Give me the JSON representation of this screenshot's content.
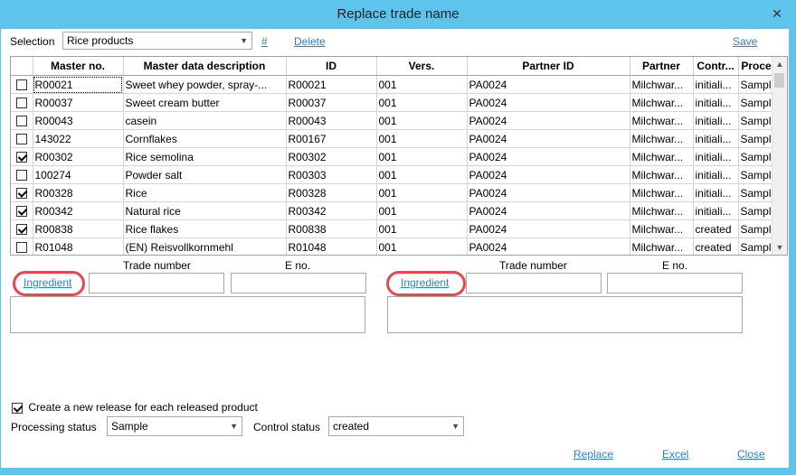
{
  "window": {
    "title": "Replace trade name",
    "close_glyph": "✕"
  },
  "toolbar": {
    "selection_label": "Selection",
    "selection_value": "Rice products",
    "hash_link": "#",
    "delete_link": "Delete",
    "save_link": "Save"
  },
  "grid": {
    "columns": [
      "",
      "Master no.",
      "Master data description",
      "ID",
      "Vers.",
      "Partner ID",
      "Partner",
      "Contr...",
      "Proce"
    ],
    "rows": [
      {
        "checked": false,
        "master_no": "R00021",
        "desc": "Sweet whey powder, spray-...",
        "id": "R00021",
        "vers": "001",
        "partner_id": "PA0024",
        "partner": "Milchwar...",
        "control": "initiali...",
        "process": "Sampl"
      },
      {
        "checked": false,
        "master_no": "R00037",
        "desc": "Sweet cream butter",
        "id": "R00037",
        "vers": "001",
        "partner_id": "PA0024",
        "partner": "Milchwar...",
        "control": "initiali...",
        "process": "Sampl"
      },
      {
        "checked": false,
        "master_no": "R00043",
        "desc": "casein",
        "id": "R00043",
        "vers": "001",
        "partner_id": "PA0024",
        "partner": "Milchwar...",
        "control": "initiali...",
        "process": "Sampl"
      },
      {
        "checked": false,
        "master_no": "143022",
        "desc": "Cornflakes",
        "id": "R00167",
        "vers": "001",
        "partner_id": "PA0024",
        "partner": "Milchwar...",
        "control": "initiali...",
        "process": "Sampl"
      },
      {
        "checked": true,
        "master_no": "R00302",
        "desc": "Rice semolina",
        "id": "R00302",
        "vers": "001",
        "partner_id": "PA0024",
        "partner": "Milchwar...",
        "control": "initiali...",
        "process": "Sampl"
      },
      {
        "checked": false,
        "master_no": "100274",
        "desc": "Powder salt",
        "id": "R00303",
        "vers": "001",
        "partner_id": "PA0024",
        "partner": "Milchwar...",
        "control": "initiali...",
        "process": "Sampl"
      },
      {
        "checked": true,
        "master_no": "R00328",
        "desc": "Rice",
        "id": "R00328",
        "vers": "001",
        "partner_id": "PA0024",
        "partner": "Milchwar...",
        "control": "initiali...",
        "process": "Sampl"
      },
      {
        "checked": true,
        "master_no": "R00342",
        "desc": "Natural rice",
        "id": "R00342",
        "vers": "001",
        "partner_id": "PA0024",
        "partner": "Milchwar...",
        "control": "initiali...",
        "process": "Sampl"
      },
      {
        "checked": true,
        "master_no": "R00838",
        "desc": "Rice flakes",
        "id": "R00838",
        "vers": "001",
        "partner_id": "PA0024",
        "partner": "Milchwar...",
        "control": "created",
        "process": "Sampl"
      },
      {
        "checked": false,
        "master_no": "R01048",
        "desc": "(EN) Reisvollkornmehl",
        "id": "R01048",
        "vers": "001",
        "partner_id": "PA0024",
        "partner": "Milchwar...",
        "control": "created",
        "process": "Sampl"
      }
    ]
  },
  "left_panel": {
    "trade_number_label": "Trade number",
    "e_no_label": "E no.",
    "ingredient_link": "Ingredient"
  },
  "right_panel": {
    "trade_number_label": "Trade number",
    "e_no_label": "E no.",
    "ingredient_link": "Ingredient"
  },
  "options": {
    "new_release_label": "Create a new release for each released product",
    "new_release_checked": true,
    "processing_status_label": "Processing status",
    "processing_status_value": "Sample",
    "control_status_label": "Control status",
    "control_status_value": "created"
  },
  "footer": {
    "replace_link": "Replace",
    "excel_link": "Excel",
    "close_link": "Close"
  },
  "colors": {
    "frame": "#5ec4ec",
    "link": "#2b7fd0",
    "highlight_oval": "#e8474e"
  }
}
